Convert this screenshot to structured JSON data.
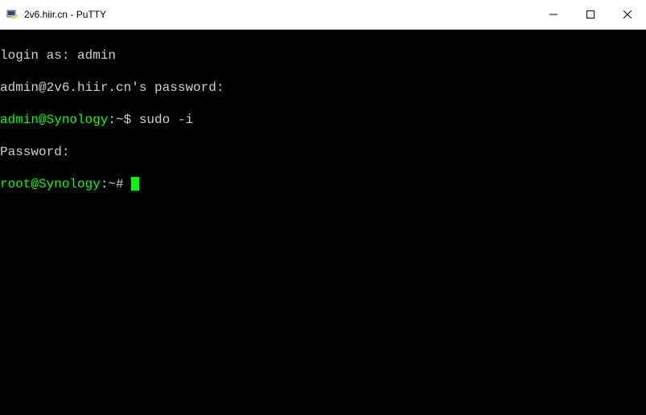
{
  "window": {
    "title": "2v6.hiir.cn - PuTTY"
  },
  "terminal": {
    "line1_label": "login as: ",
    "line1_value": "admin",
    "line2": "admin@2v6.hiir.cn's password:",
    "line3_user": "admin@Synology",
    "line3_sep": ":~$ ",
    "line3_cmd": "sudo -i",
    "line4": "Password:",
    "line5_user": "root@Synology",
    "line5_sep": ":~# "
  }
}
